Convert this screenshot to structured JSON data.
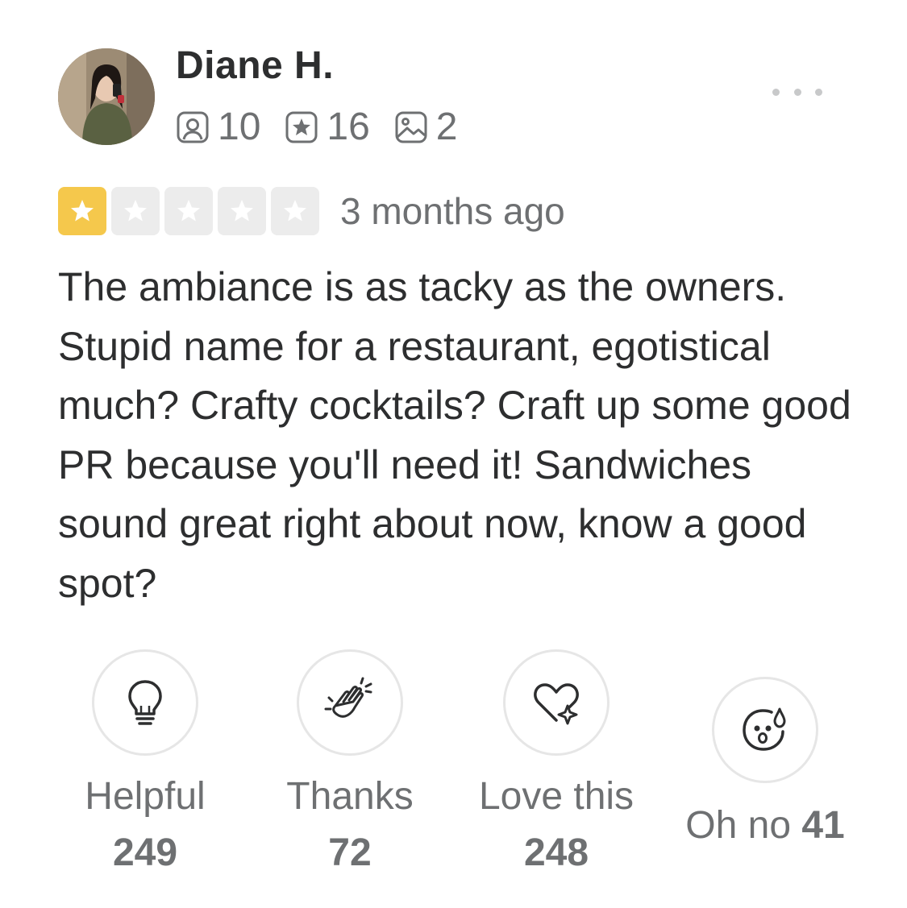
{
  "user": {
    "name": "Diane H.",
    "friends_count": "10",
    "reviews_count": "16",
    "photos_count": "2"
  },
  "review": {
    "rating": 1,
    "max_rating": 5,
    "time_ago": "3 months ago",
    "text": "The ambiance is as tacky as the owners. Stupid name for a restaurant, egotistical much? Crafty cocktails? Craft up some good PR because you'll need it! Sandwiches sound great right about now, know a good spot?"
  },
  "reactions": [
    {
      "label": "Helpful",
      "count": "249",
      "icon": "lightbulb-icon"
    },
    {
      "label": "Thanks",
      "count": "72",
      "icon": "clapping-hands-icon"
    },
    {
      "label": "Love this",
      "count": "248",
      "icon": "heart-sparkle-icon"
    },
    {
      "label": "Oh no",
      "count": "41",
      "icon": "surprised-face-icon"
    }
  ],
  "colors": {
    "star_filled": "#f5c84c",
    "star_empty": "#ececec",
    "text_primary": "#2d2e2f",
    "text_secondary": "#6e7072"
  }
}
